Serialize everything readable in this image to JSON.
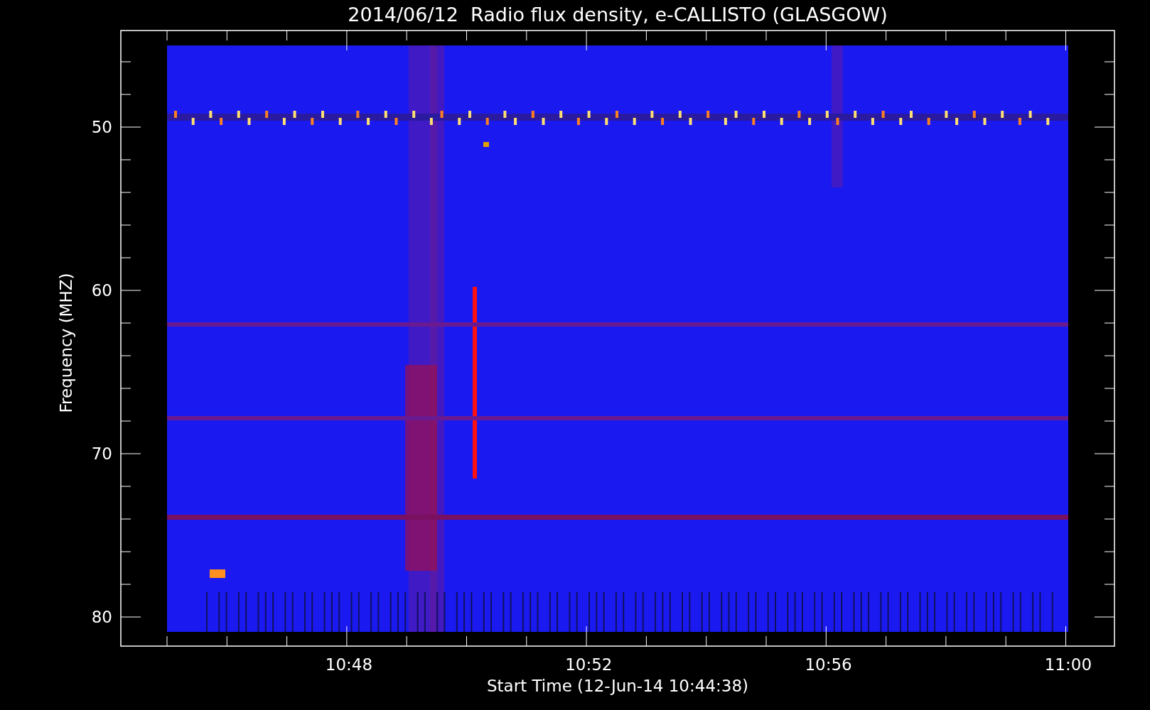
{
  "title": "2014/06/12  Radio flux density, e-CALLISTO (GLASGOW)",
  "y_axis": {
    "label": "Frequency (MHZ)",
    "ticks": [
      "50",
      "60",
      "70",
      "80"
    ]
  },
  "x_axis": {
    "label": "Start Time (12-Jun-14 10:44:38)",
    "ticks": [
      "10:48",
      "10:52",
      "10:56",
      "11:00"
    ]
  }
}
